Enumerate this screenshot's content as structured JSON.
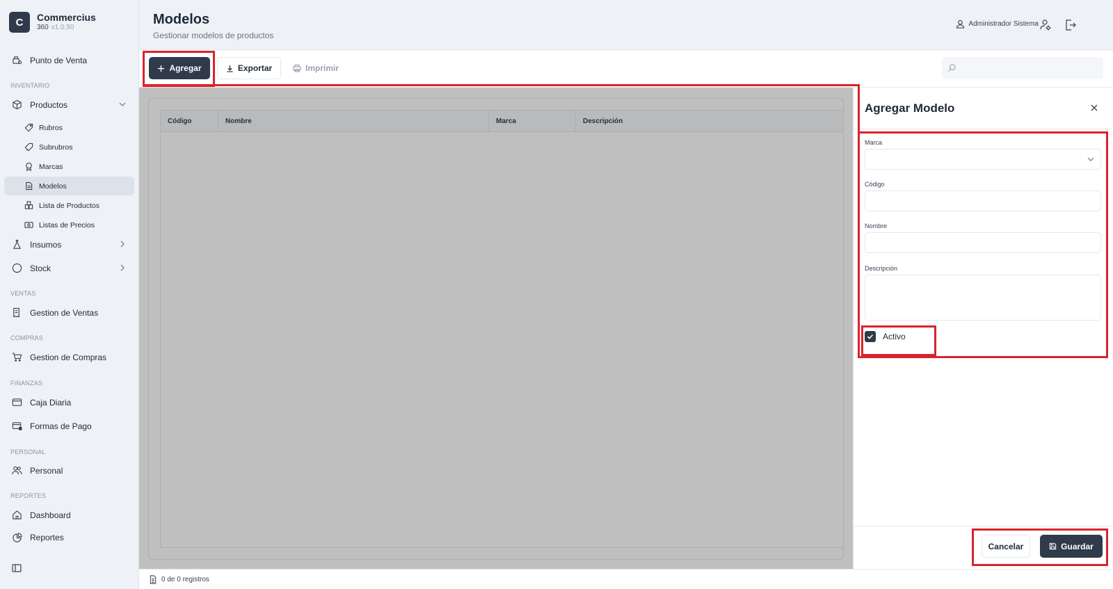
{
  "app": {
    "logo_letter": "C",
    "name": "Commercius",
    "sub": "360",
    "version": "v1.0.50"
  },
  "sidebar": {
    "pos": "Punto de Venta",
    "sections": {
      "inventario": "INVENTARIO",
      "ventas": "VENTAS",
      "compras": "COMPRAS",
      "finanzas": "FINANZAS",
      "personal": "PERSONAL",
      "reportes": "REPORTES"
    },
    "productos": "Productos",
    "sub": {
      "rubros": "Rubros",
      "subrubros": "Subrubros",
      "marcas": "Marcas",
      "modelos": "Modelos",
      "lista_productos": "Lista de Productos",
      "listas_precios": "Listas de Precios"
    },
    "insumos": "Insumos",
    "stock": "Stock",
    "gestion_ventas": "Gestion de Ventas",
    "gestion_compras": "Gestion de Compras",
    "caja_diaria": "Caja Diaria",
    "formas_pago": "Formas de Pago",
    "personal": "Personal",
    "dashboard": "Dashboard",
    "reportes": "Reportes"
  },
  "header": {
    "title": "Modelos",
    "subtitle": "Gestionar modelos de productos",
    "user": "Administrador Sistema"
  },
  "toolbar": {
    "add": "Agregar",
    "export": "Exportar",
    "print": "Imprimir",
    "search_placeholder": ""
  },
  "table": {
    "columns": [
      "Código",
      "Nombre",
      "Marca",
      "Descripción"
    ]
  },
  "footer": {
    "records": "0 de 0 registros"
  },
  "panel": {
    "title": "Agregar Modelo",
    "fields": {
      "marca": "Marca",
      "codigo": "Código",
      "nombre": "Nombre",
      "descripcion": "Descripción"
    },
    "activo_label": "Activo",
    "activo_checked": true,
    "cancel": "Cancelar",
    "save": "Guardar"
  },
  "colors": {
    "primary": "#2f3a4b",
    "highlight": "#d9232d",
    "sidebar_bg": "#eef1f6"
  }
}
